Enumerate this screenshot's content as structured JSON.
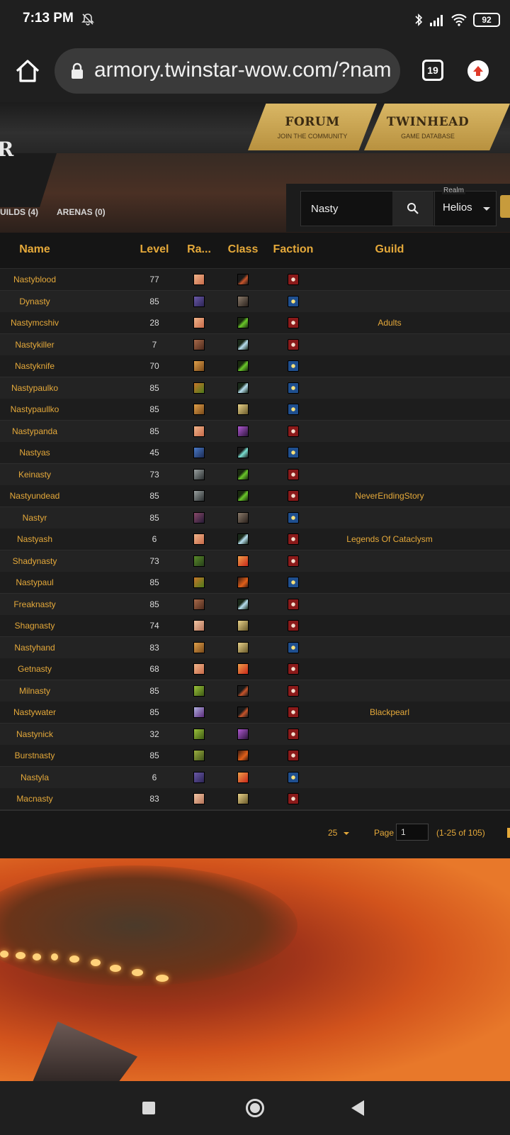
{
  "status_bar": {
    "time": "7:13 PM",
    "battery": "92",
    "icons": [
      "bell-off-icon",
      "bluetooth-icon",
      "signal-icon",
      "wifi-icon",
      "battery-icon"
    ]
  },
  "browser": {
    "url": "armory.twinstar-wow.com/?nam",
    "tab_count": "19",
    "icons": [
      "home-icon",
      "lock-icon",
      "update-icon"
    ]
  },
  "site": {
    "logo_fragment": "R",
    "nav": [
      {
        "title": "FORUM",
        "subtitle": "JOIN THE COMMUNITY"
      },
      {
        "title": "TWINHEAD",
        "subtitle": "GAME DATABASE"
      }
    ],
    "tabs": {
      "guilds": "UILDS (4)",
      "arenas": "ARENAS (0)"
    },
    "search": {
      "value": "Nasty",
      "realm_label": "Realm",
      "realm_value": "Helios"
    }
  },
  "table": {
    "columns": {
      "name": "Name",
      "level": "Level",
      "race": "Ra...",
      "class": "Class",
      "faction": "Faction",
      "guild": "Guild"
    },
    "rows": [
      {
        "name": "Nastyblood",
        "level": "77",
        "guild": "",
        "race": "human-female",
        "class": "rogue",
        "faction": "horde"
      },
      {
        "name": "Dynasty",
        "level": "85",
        "guild": "",
        "race": "draenei-male",
        "class": "warrior",
        "faction": "alliance"
      },
      {
        "name": "Nastymcshiv",
        "level": "28",
        "guild": "Adults",
        "race": "human-female",
        "class": "hunter",
        "faction": "horde"
      },
      {
        "name": "Nastykiller",
        "level": "7",
        "guild": "",
        "race": "orc-male",
        "class": "warrior-sword",
        "faction": "horde"
      },
      {
        "name": "Nastyknife",
        "level": "70",
        "guild": "",
        "race": "dwarf-male",
        "class": "hunter",
        "faction": "alliance"
      },
      {
        "name": "Nastypaulko",
        "level": "85",
        "guild": "",
        "race": "goblin-male",
        "class": "warrior-sword",
        "faction": "alliance"
      },
      {
        "name": "Nastypaullko",
        "level": "85",
        "guild": "",
        "race": "dwarf-male",
        "class": "paladin",
        "faction": "alliance"
      },
      {
        "name": "Nastypanda",
        "level": "85",
        "guild": "",
        "race": "human-female",
        "class": "mage",
        "faction": "horde"
      },
      {
        "name": "Nastyas",
        "level": "45",
        "guild": "",
        "race": "troll-male",
        "class": "shaman",
        "faction": "alliance"
      },
      {
        "name": "Keinasty",
        "level": "73",
        "guild": "",
        "race": "undead-male",
        "class": "hunter",
        "faction": "horde"
      },
      {
        "name": "Nastyundead",
        "level": "85",
        "guild": "NeverEndingStory",
        "race": "undead-male",
        "class": "hunter",
        "faction": "horde"
      },
      {
        "name": "Nastyr",
        "level": "85",
        "guild": "",
        "race": "nightelf-male",
        "class": "warrior",
        "faction": "alliance"
      },
      {
        "name": "Nastyash",
        "level": "6",
        "guild": "Legends Of Cataclysm",
        "race": "human-female",
        "class": "warrior-sword",
        "faction": "horde"
      },
      {
        "name": "Shadynasty",
        "level": "73",
        "guild": "",
        "race": "orc-green",
        "class": "warlock",
        "faction": "horde"
      },
      {
        "name": "Nastypaul",
        "level": "85",
        "guild": "",
        "race": "goblin-male",
        "class": "druid",
        "faction": "alliance"
      },
      {
        "name": "Freaknasty",
        "level": "85",
        "guild": "",
        "race": "orc-male",
        "class": "warrior-sword",
        "faction": "horde"
      },
      {
        "name": "Shagnasty",
        "level": "74",
        "guild": "",
        "race": "human-female-2",
        "class": "paladin",
        "faction": "horde"
      },
      {
        "name": "Nastyhand",
        "level": "83",
        "guild": "",
        "race": "dwarf-male",
        "class": "paladin",
        "faction": "alliance"
      },
      {
        "name": "Getnasty",
        "level": "68",
        "guild": "",
        "race": "human-female",
        "class": "warlock",
        "faction": "horde"
      },
      {
        "name": "Milnasty",
        "level": "85",
        "guild": "",
        "race": "goblin-green",
        "class": "rogue",
        "faction": "horde"
      },
      {
        "name": "Nastywater",
        "level": "85",
        "guild": "Blackpearl",
        "race": "gnome-purple",
        "class": "rogue",
        "faction": "horde"
      },
      {
        "name": "Nastynick",
        "level": "32",
        "guild": "",
        "race": "goblin-green",
        "class": "mage",
        "faction": "horde"
      },
      {
        "name": "Burstnasty",
        "level": "85",
        "guild": "",
        "race": "goblin-green-2",
        "class": "druid",
        "faction": "horde"
      },
      {
        "name": "Nastyla",
        "level": "6",
        "guild": "",
        "race": "draenei-male",
        "class": "warlock",
        "faction": "alliance"
      },
      {
        "name": "Macnasty",
        "level": "83",
        "guild": "",
        "race": "human-female-2",
        "class": "paladin",
        "faction": "horde"
      }
    ],
    "pagination": {
      "per_page": "25",
      "page_label": "Page",
      "page_value": "1",
      "range": "(1-25 of 105)"
    }
  },
  "colors": {
    "accent": "#e5a93a",
    "gold_tab": "#c9a24a",
    "table_bg": "#1f1f1f",
    "horde": "#8b1a1a",
    "alliance": "#1f4f8f"
  }
}
